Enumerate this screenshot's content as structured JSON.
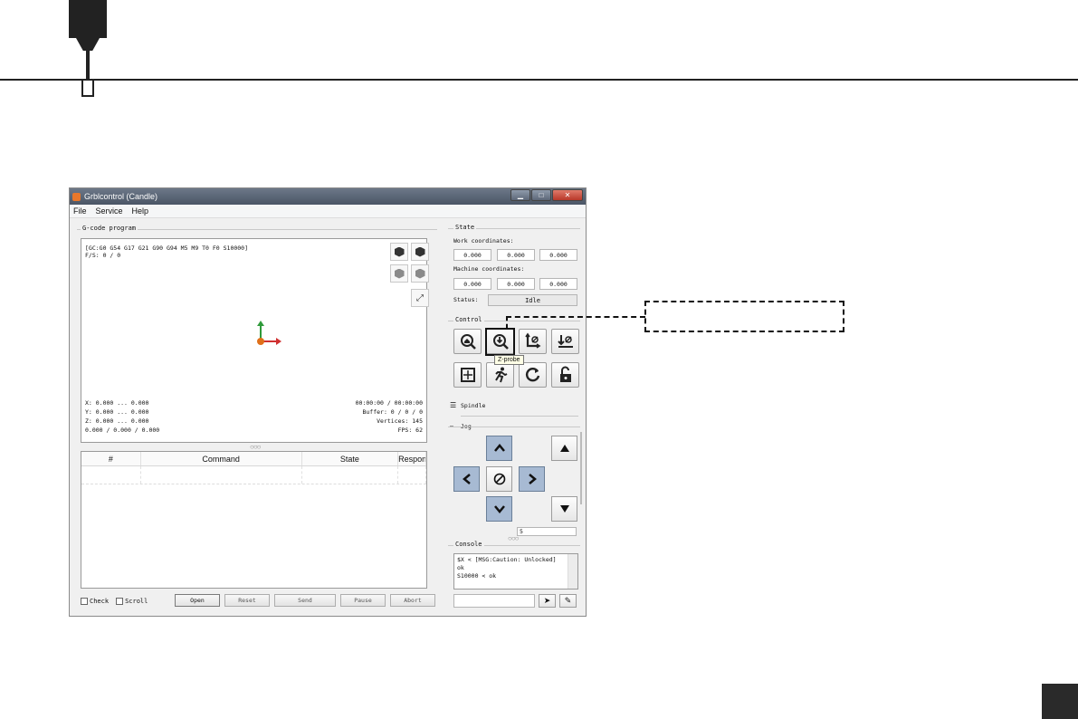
{
  "window": {
    "title": "Grblcontrol (Candle)",
    "menu": [
      "File",
      "Service",
      "Help"
    ]
  },
  "gcode_group_label": "G-code program",
  "viewer": {
    "status_line_1": "[GC:G0 G54 G17 G21 G90 G94 M5 M9 T0 F0 S10000]",
    "status_line_2": "F/S: 0 / 0",
    "x_range": "X: 0.000 ... 0.000",
    "y_range": "Y: 0.000 ... 0.000",
    "z_range": "Z: 0.000 ... 0.000",
    "dims": "0.000 / 0.000 / 0.000",
    "time": "00:00:00 / 00:00:00",
    "buffer": "Buffer: 0 / 0 / 0",
    "vertices": "Vertices: 145",
    "fps": "FPS: 62"
  },
  "table": {
    "columns": [
      "#",
      "Command",
      "State",
      "Response"
    ]
  },
  "bottom": {
    "check_label": "Check",
    "scroll_label": "Scroll",
    "open": "Open",
    "reset": "Reset",
    "send": "Send",
    "pause": "Pause",
    "abort": "Abort"
  },
  "state": {
    "group_label": "State",
    "work_label": "Work coordinates:",
    "work": [
      "0.000",
      "0.000",
      "0.000"
    ],
    "machine_label": "Machine coordinates:",
    "machine": [
      "0.000",
      "0.000",
      "0.000"
    ],
    "status_label": "Status:",
    "status_value": "Idle"
  },
  "control": {
    "group_label": "Control",
    "tooltip": "Z-probe"
  },
  "spindle_label": "Spindle",
  "jog_label": "Jog",
  "jog_step_value": "5",
  "console": {
    "label": "Console",
    "lines": [
      "$X < [MSG:Caution: Unlocked]",
      "ok",
      "S10000 < ok"
    ]
  }
}
